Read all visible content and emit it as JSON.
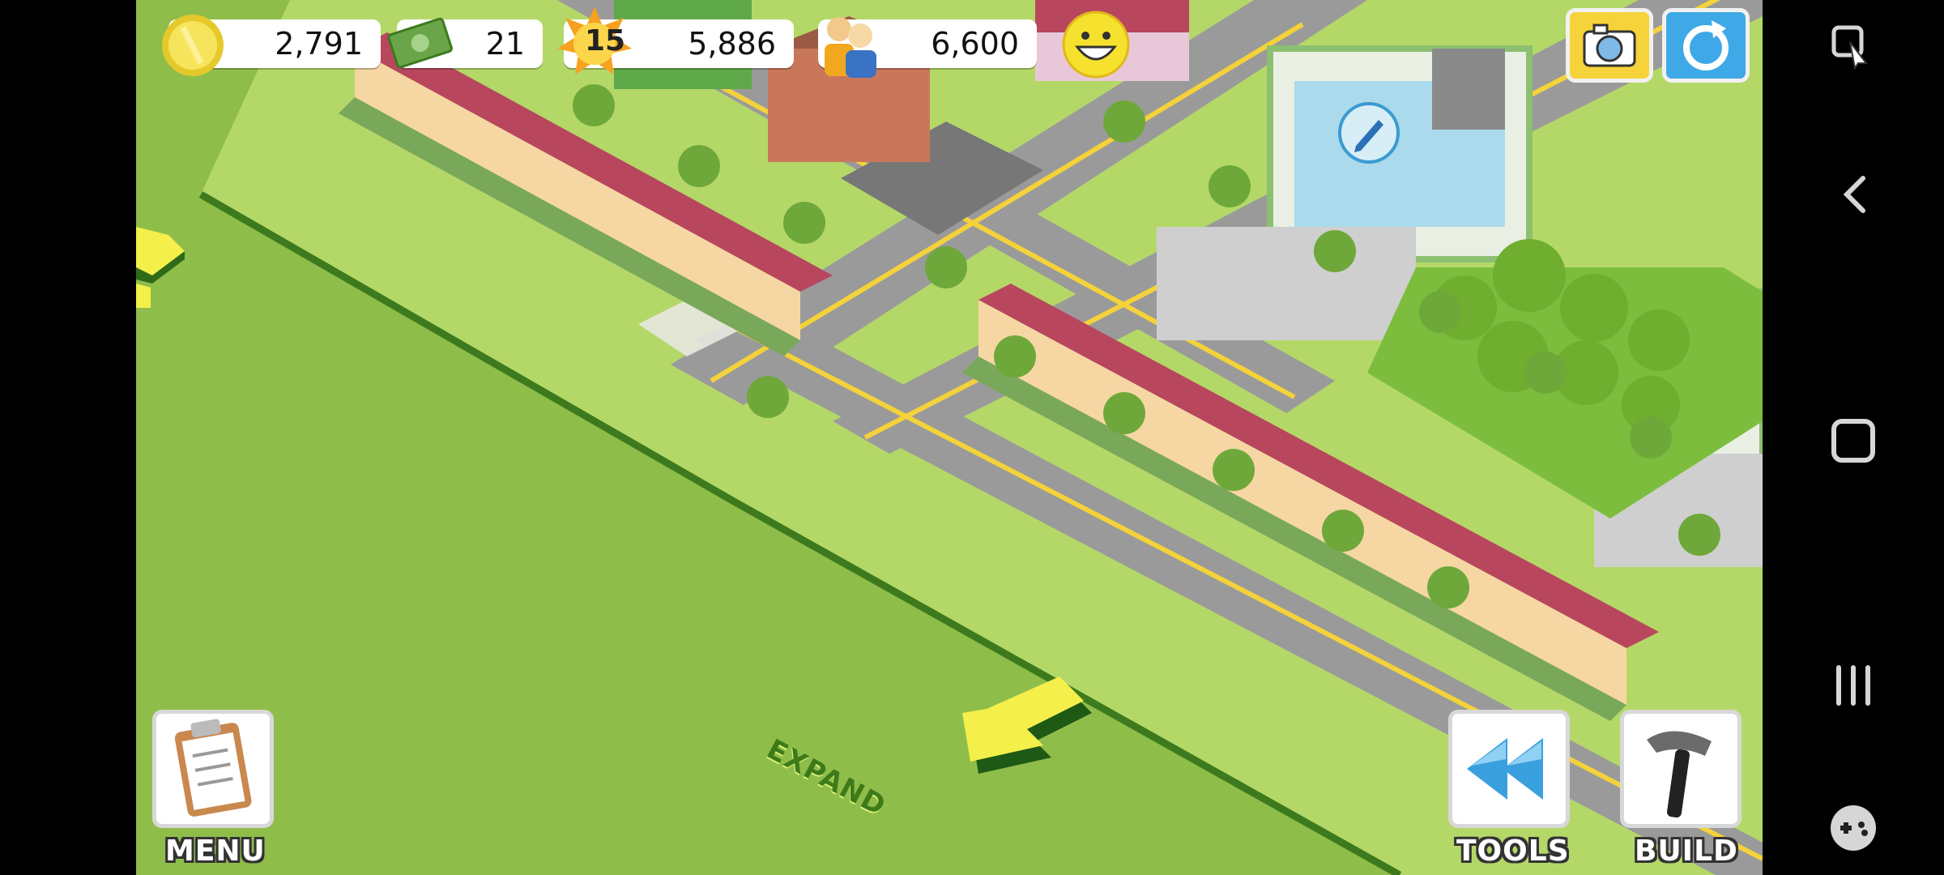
{
  "hud": {
    "coins": "2,791",
    "cash": "21",
    "level": "15",
    "xp": "5,886",
    "population": "6,600",
    "mood_icon": "smiley-icon"
  },
  "buttons": {
    "menu": "MENU",
    "tools": "TOOLS",
    "build": "BUILD",
    "expand": "EXPAND",
    "camera_icon": "camera-icon",
    "share_icon": "share-icon"
  },
  "navbar": {
    "icons": [
      "screenshot-edit-icon",
      "back-icon",
      "home-icon",
      "recents-icon",
      "game-controller-icon"
    ]
  }
}
